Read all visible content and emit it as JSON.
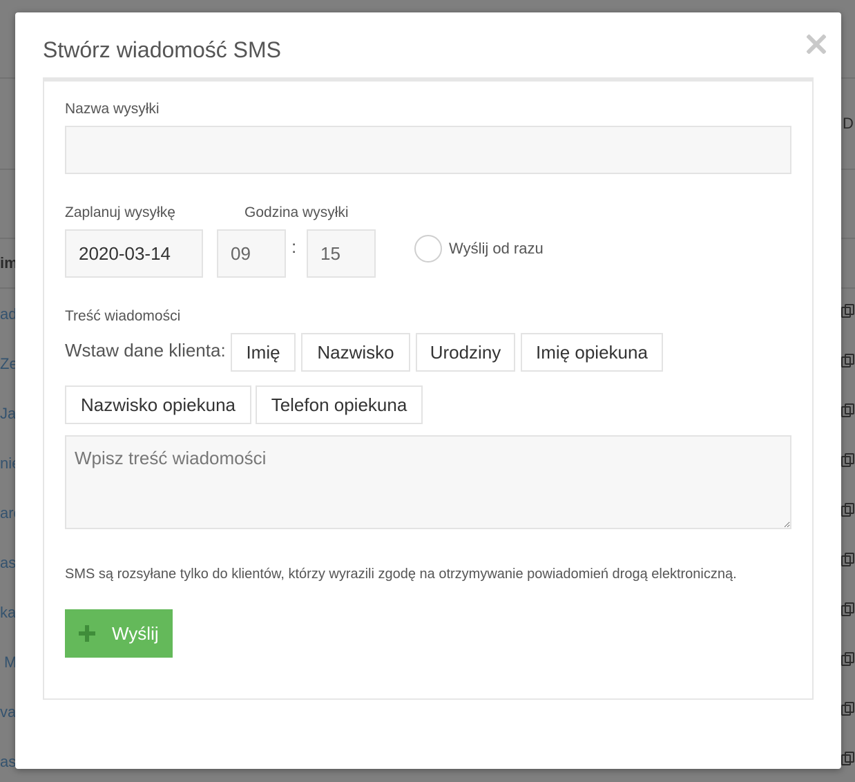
{
  "modal": {
    "title": "Stwórz wiadomość SMS",
    "close_icon": "close-icon"
  },
  "form": {
    "name_label": "Nazwa wysyłki",
    "name_value": "",
    "schedule_label": "Zaplanuj wysyłkę",
    "hour_label": "Godzina wysyłki",
    "date_value": "2020-03-14",
    "hour_value": "09",
    "time_separator": ":",
    "minute_value": "15",
    "send_now_label": "Wyślij od razu",
    "send_now_checked": false,
    "message_label": "Treść wiadomości",
    "insert_label": "Wstaw dane klienta:",
    "insert_buttons": [
      "Imię",
      "Nazwisko",
      "Urodziny",
      "Imię opiekuna",
      "Nazwisko opiekuna",
      "Telefon opiekuna"
    ],
    "message_placeholder": "Wpisz treść wiadomości",
    "message_value": "",
    "consent_note": "SMS są rozsyłane tylko do klientów, którzy wyrazili zgodę na otrzymywanie powiadomień drogą elektroniczną.",
    "send_label": "Wyślij",
    "send_icon": "plus-icon"
  },
  "background": {
    "left_fragments": [
      "im",
      "ade",
      "Zen",
      "Jan",
      "nie",
      "aro",
      "asz",
      "ka",
      "M",
      "va",
      "asz"
    ],
    "right_header_fragment": "D"
  },
  "colors": {
    "overlay": "#7f7f7f",
    "send_button": "#64b95a",
    "plus_icon": "#3f8d3a",
    "field_bg": "#f7f7f7",
    "border": "#e3e3e3",
    "title_text": "#555555"
  }
}
